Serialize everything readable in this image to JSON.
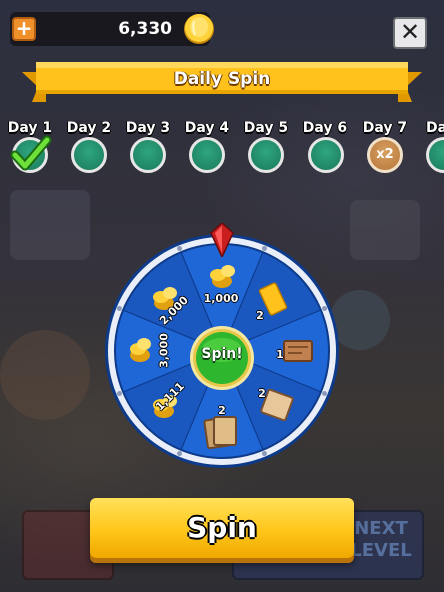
{
  "hud": {
    "coins": "6,330",
    "plus_symbol": "+",
    "close_symbol": "✕"
  },
  "header": {
    "title": "Daily Spin"
  },
  "days": [
    {
      "label": "Day 1",
      "state": "claimed"
    },
    {
      "label": "Day 2",
      "state": "upcoming"
    },
    {
      "label": "Day 3",
      "state": "upcoming"
    },
    {
      "label": "Day 4",
      "state": "upcoming"
    },
    {
      "label": "Day 5",
      "state": "upcoming"
    },
    {
      "label": "Day 6",
      "state": "upcoming"
    },
    {
      "label": "Day 7",
      "state": "bonus",
      "badge": "x2"
    },
    {
      "label": "Day",
      "state": "upcoming"
    }
  ],
  "wheel": {
    "center_label": "Spin!",
    "segments": [
      {
        "reward": "coins",
        "amount": "1,000",
        "icon": "coin-pile-icon"
      },
      {
        "reward": "ticket",
        "amount": "2",
        "icon": "ticket-icon"
      },
      {
        "reward": "map-piece",
        "amount": "1",
        "icon": "map-icon"
      },
      {
        "reward": "map-scroll",
        "amount": "2",
        "icon": "scroll-map-icon"
      },
      {
        "reward": "cards",
        "amount": "2",
        "icon": "cards-icon"
      },
      {
        "reward": "coins",
        "amount": "1,111",
        "icon": "coin-pile-icon"
      },
      {
        "reward": "coins",
        "amount": "3,000",
        "icon": "coin-pile-icon"
      },
      {
        "reward": "coins",
        "amount": "2,000",
        "icon": "coin-pile-icon"
      }
    ]
  },
  "footer": {
    "spin_label": "Spin",
    "next_level_label": "NEXT LEVEL"
  },
  "colors": {
    "ribbon": "#ffc21c",
    "wheel_blue": "#1f66d6",
    "wheel_blue_alt": "#1a58bf",
    "wheel_rim": "#e9eef8",
    "center_green": "#2fb62f",
    "button_yellow": "#ffc61a",
    "day_green": "#23906c",
    "day_bonus": "#c98a4a"
  }
}
